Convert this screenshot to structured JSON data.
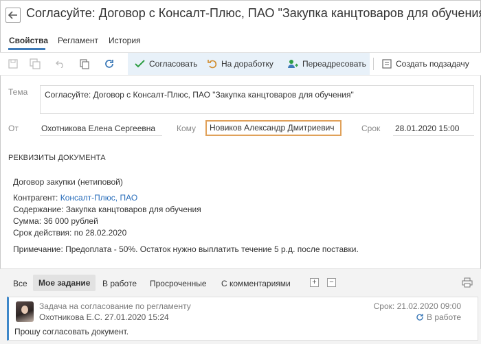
{
  "header": {
    "title": "Согласуйте: Договор с Консалт-Плюс, ПАО \"Закупка канцтоваров для обучения"
  },
  "tabs": [
    {
      "label": "Свойства"
    },
    {
      "label": "Регламент"
    },
    {
      "label": "История"
    }
  ],
  "toolbar": {
    "approve_label": "Согласовать",
    "rework_label": "На доработку",
    "redirect_label": "Переадресовать",
    "subtask_label": "Создать подзадачу"
  },
  "form": {
    "topic_label": "Тема",
    "topic_value": "Согласуйте: Договор с Консалт-Плюс, ПАО \"Закупка канцтоваров для обучения\"",
    "from_label": "От",
    "from_value": "Охотникова Елена Сергеевна",
    "to_label": "Кому",
    "to_value": "Новиков Александр Дмитриевич",
    "deadline_label": "Срок",
    "deadline_value": "28.01.2020 15:00"
  },
  "requisites": {
    "title": "РЕКВИЗИТЫ ДОКУМЕНТА",
    "doc_type": "Договор закупки (нетиповой)",
    "contractor_label": "Контрагент: ",
    "contractor_value": "Консалт-Плюс, ПАО",
    "content": "Содержание: Закупка канцтоваров для обучения",
    "sum": "Сумма: 36 000 рублей",
    "validity": "Срок действия: по 28.02.2020",
    "note": "Примечание: Предоплата - 50%. Остаток нужно выплатить течение 5 р.д. после поставки."
  },
  "filters": [
    {
      "label": "Все"
    },
    {
      "label": "Мое задание"
    },
    {
      "label": "В работе"
    },
    {
      "label": "Просроченные"
    },
    {
      "label": "С комментариями"
    }
  ],
  "task": {
    "title": "Задача на согласование по регламенту",
    "meta": "Охотникова Е.С.  27.01.2020 15:24",
    "deadline": "Срок: 21.02.2020 09:00",
    "status": "В работе",
    "text": "Прошу согласовать документ."
  },
  "colors": {
    "accent": "#3d7ab8",
    "highlight": "#e0a15a",
    "toolbar_group": "#e8f1f9",
    "approve_green": "#2e9e44"
  }
}
